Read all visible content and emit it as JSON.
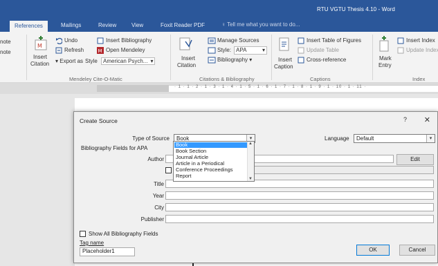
{
  "window": {
    "title": "RTU VGTU Thesis 4.10 - Word"
  },
  "tabs": [
    {
      "label": "References",
      "active": true
    },
    {
      "label": "Mailings"
    },
    {
      "label": "Review"
    },
    {
      "label": "View"
    },
    {
      "label": "Foxit Reader PDF"
    }
  ],
  "tell_me": "Tell me what you want to do...",
  "ribbon": {
    "left_cut": {
      "line1": "note",
      "line2": "note"
    },
    "insert_citation": {
      "line1": "Insert",
      "line2": "Citation"
    },
    "mendeley": {
      "undo": "Undo",
      "refresh": "Refresh",
      "export_as": "Export as",
      "insert_bibliography": "Insert Bibliography",
      "open_mendeley": "Open Mendeley",
      "style_label": "Style",
      "style_value": "American Psych...",
      "group_label": "Mendeley Cite-O-Matic"
    },
    "citations": {
      "insert_citation_line1": "Insert",
      "insert_citation_line2": "Citation",
      "manage_sources": "Manage Sources",
      "style_label": "Style:",
      "style_value": "APA",
      "bibliography": "Bibliography",
      "group_label": "Citations & Bibliography"
    },
    "captions": {
      "insert_caption_line1": "Insert",
      "insert_caption_line2": "Caption",
      "insert_table_of_figures": "Insert Table of Figures",
      "update_table": "Update Table",
      "cross_reference": "Cross-reference",
      "group_label": "Captions"
    },
    "index": {
      "mark_entry_line1": "Mark",
      "mark_entry_line2": "Entry",
      "insert_index": "Insert Index",
      "update_index": "Update Index",
      "group_label": "Index"
    }
  },
  "ruler": {
    "numbers": "· 1 · 1 · 2 · 1 · 3 · 1 · 4 · 1 · 5 · 1 · 6 · 1 · 7 · 1 · 8 · 1 · 9 · 1 · 10 · 1 · 11 ·"
  },
  "dialog": {
    "title": "Create Source",
    "help": "?",
    "close": "✕",
    "type_of_source_label": "Type of Source",
    "type_of_source_value": "Book",
    "source_options": [
      "Book",
      "Book Section",
      "Journal Article",
      "Article in a Periodical",
      "Conference Proceedings",
      "Report"
    ],
    "selected_option": "Book",
    "language_label": "Language",
    "language_value": "Default",
    "section_label": "Bibliography Fields for APA",
    "fields": [
      {
        "label": "Author",
        "value": ""
      },
      {
        "label": "Title",
        "value": ""
      },
      {
        "label": "Year",
        "value": ""
      },
      {
        "label": "City",
        "value": ""
      },
      {
        "label": "Publisher",
        "value": ""
      }
    ],
    "edit_button": "Edit",
    "show_all_label": "Show All Bibliography Fields",
    "tag_name_label": "Tag name",
    "tag_name_value": "Placeholder1",
    "ok_button": "OK",
    "cancel_button": "Cancel"
  }
}
